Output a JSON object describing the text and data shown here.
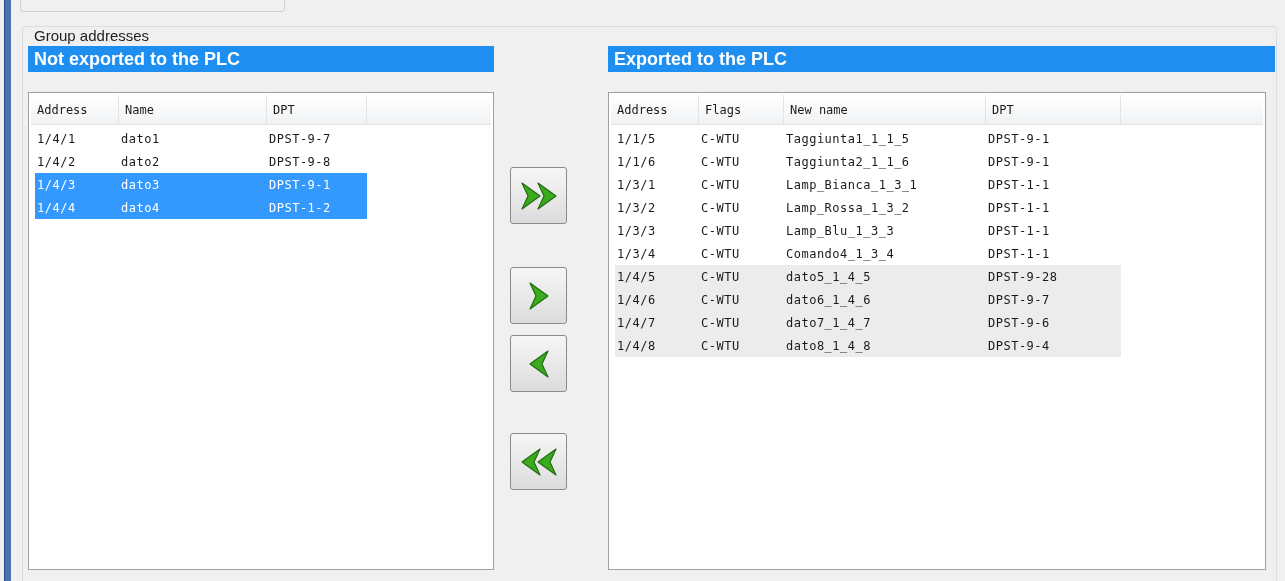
{
  "group_box": {
    "title": "Group addresses"
  },
  "lists": [
    {
      "title": "Not exported to the PLC",
      "kind": "source",
      "columns": [
        "Address",
        "Name",
        "DPT"
      ],
      "rows": [
        {
          "cells": [
            "1/4/1",
            "dato1",
            "DPST-9-7"
          ],
          "selected": false
        },
        {
          "cells": [
            "1/4/2",
            "dato2",
            "DPST-9-8"
          ],
          "selected": false
        },
        {
          "cells": [
            "1/4/3",
            "dato3",
            "DPST-9-1"
          ],
          "selected": true
        },
        {
          "cells": [
            "1/4/4",
            "dato4",
            "DPST-1-2"
          ],
          "selected": true
        }
      ]
    },
    {
      "title": "Exported to the PLC",
      "kind": "target",
      "columns": [
        "Address",
        "Flags",
        "New name",
        "DPT"
      ],
      "rows": [
        {
          "cells": [
            "1/1/5",
            "C-WTU",
            "Taggiunta1_1_1_5",
            "DPST-9-1"
          ],
          "selected": false
        },
        {
          "cells": [
            "1/1/6",
            "C-WTU",
            "Taggiunta2_1_1_6",
            "DPST-9-1"
          ],
          "selected": false
        },
        {
          "cells": [
            "1/3/1",
            "C-WTU",
            "Lamp_Bianca_1_3_1",
            "DPST-1-1"
          ],
          "selected": false
        },
        {
          "cells": [
            "1/3/2",
            "C-WTU",
            "Lamp_Rossa_1_3_2",
            "DPST-1-1"
          ],
          "selected": false
        },
        {
          "cells": [
            "1/3/3",
            "C-WTU",
            "Lamp_Blu_1_3_3",
            "DPST-1-1"
          ],
          "selected": false
        },
        {
          "cells": [
            "1/3/4",
            "C-WTU",
            "Comando4_1_3_4",
            "DPST-1-1"
          ],
          "selected": false
        },
        {
          "cells": [
            "1/4/5",
            "C-WTU",
            "dato5_1_4_5",
            "DPST-9-28"
          ],
          "selected": true
        },
        {
          "cells": [
            "1/4/6",
            "C-WTU",
            "dato6_1_4_6",
            "DPST-9-7"
          ],
          "selected": true
        },
        {
          "cells": [
            "1/4/7",
            "C-WTU",
            "dato7_1_4_7",
            "DPST-9-6"
          ],
          "selected": true
        },
        {
          "cells": [
            "1/4/8",
            "C-WTU",
            "dato8_1_4_8",
            "DPST-9-4"
          ],
          "selected": true
        }
      ]
    }
  ],
  "transfer_buttons": [
    {
      "kind": "add_all"
    },
    {
      "kind": "add"
    },
    {
      "kind": "remove"
    },
    {
      "kind": "remove_all"
    }
  ]
}
